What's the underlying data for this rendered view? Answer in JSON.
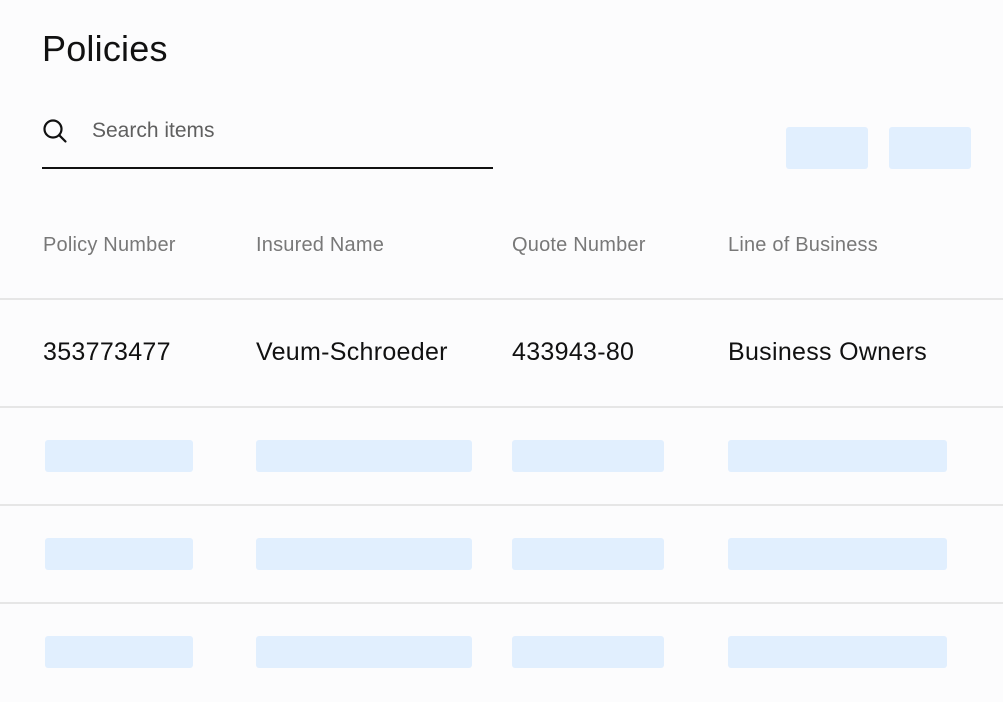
{
  "page": {
    "title": "Policies"
  },
  "search": {
    "placeholder": "Search items",
    "value": "",
    "icon": "search-icon"
  },
  "toolbar": {
    "buttons_loading": 2
  },
  "table": {
    "columns": [
      "Policy Number",
      "Insured Name",
      "Quote Number",
      "Line of Business"
    ],
    "rows": [
      {
        "policy_number": "353773477",
        "insured_name": "Veum-Schroeder",
        "quote_number": "433943-80",
        "line_of_business": "Business Owners"
      }
    ],
    "loading_rows": 3
  },
  "colors": {
    "skeleton": "#e1effe",
    "divider": "#e6e6e6",
    "header_text": "#787878",
    "text": "#111111",
    "background": "#fcfcfd"
  }
}
